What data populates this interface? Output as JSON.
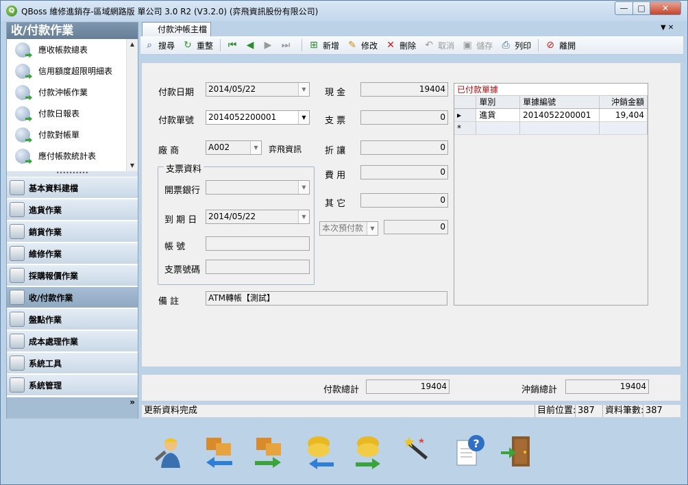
{
  "window": {
    "title": "QBoss 維修進銷存-區域網路版 單公司 3.0 R2 (V3.2.0) (弈飛資訊股份有限公司)",
    "app_icon": "Q",
    "controls": {
      "minimize": "—",
      "maximize": "□",
      "close": "✕"
    }
  },
  "nav": {
    "header": "收/付款作業",
    "items": [
      {
        "label": "應收帳款總表",
        "icon": "report-arrow-icon"
      },
      {
        "label": "信用額度超限明細表",
        "icon": "report-arrow-icon"
      },
      {
        "label": "付款沖帳作業",
        "icon": "report-arrow-icon"
      },
      {
        "label": "付款日報表",
        "icon": "report-arrow-icon"
      },
      {
        "label": "付款對帳單",
        "icon": "report-arrow-icon"
      },
      {
        "label": "應付帳款統計表",
        "icon": "report-arrow-icon"
      }
    ],
    "splitter": "••••••••••",
    "groups": [
      {
        "label": "基本資料建檔",
        "icon": "document-icon"
      },
      {
        "label": "進貨作業",
        "icon": "clipboard-icon"
      },
      {
        "label": "銷貨作業",
        "icon": "clipboard-icon"
      },
      {
        "label": "維修作業",
        "icon": "wrench-icon"
      },
      {
        "label": "採購報價作業",
        "icon": "envelope-icon"
      },
      {
        "label": "收/付款作業",
        "icon": "coin-icon"
      },
      {
        "label": "盤點作業",
        "icon": "checklist-icon"
      },
      {
        "label": "成本處理作業",
        "icon": "calculator-icon"
      },
      {
        "label": "系統工具",
        "icon": "tools-icon"
      },
      {
        "label": "系統管理",
        "icon": "gears-icon"
      }
    ],
    "expand_glyph": "»"
  },
  "tab": {
    "label": "付款沖帳主檔",
    "right_controls": "▼ ✕"
  },
  "toolbar": {
    "search": "搜尋",
    "reset": "重整",
    "add": "新增",
    "edit": "修改",
    "delete": "刪除",
    "cancel": "取消",
    "save": "儲存",
    "print": "列印",
    "exit": "離開"
  },
  "form": {
    "pay_date_label": "付款日期",
    "pay_date": "2014/05/22",
    "pay_no_label": "付款單號",
    "pay_no": "2014052200001",
    "vendor_label": "廠 商",
    "vendor_code": "A002",
    "vendor_name": "弈飛資訊",
    "cash_label": "現 金",
    "cash": "19404",
    "check_label": "支 票",
    "check": "0",
    "discount_label": "折 讓",
    "discount": "0",
    "fee_label": "費 用",
    "fee": "0",
    "other_label": "其 它",
    "other": "0",
    "prepay_label": "本次預付款",
    "prepay": "0",
    "check_group_title": "支票資料",
    "bank_label": "開票銀行",
    "bank": "",
    "due_label": "到 期 日",
    "due": "2014/05/22",
    "account_label": "帳 號",
    "account": "",
    "check_no_label": "支票號碼",
    "check_no": "",
    "remark_label": "備 註",
    "remark": "ATM轉帳【測試】"
  },
  "grid": {
    "caption": "已付款單據",
    "columns": [
      "單別",
      "單據編號",
      "沖銷金額"
    ],
    "rows": [
      {
        "marker": "▸",
        "type": "進貨",
        "number": "2014052200001",
        "amount": "19,404"
      }
    ],
    "new_row_marker": "*"
  },
  "totals": {
    "paid_label": "付款總計",
    "paid": "19404",
    "offset_label": "沖銷總計",
    "offset": "19404"
  },
  "status": {
    "message": "更新資料完成",
    "position_label": "目前位置:",
    "position": "387",
    "count_label": "資料筆數:",
    "count": "387"
  }
}
